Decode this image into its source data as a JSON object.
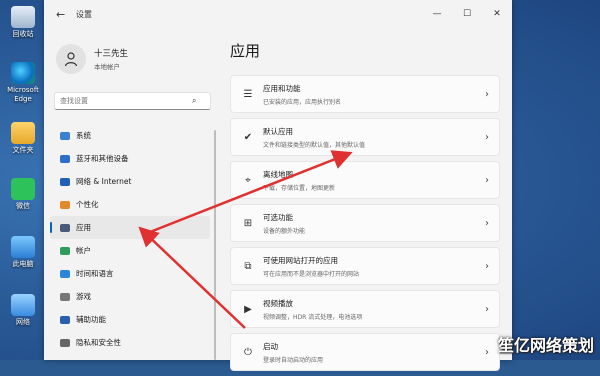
{
  "desktop": {
    "icons": [
      {
        "label": "回收站"
      },
      {
        "label": "Microsoft Edge"
      },
      {
        "label": "文件夹"
      },
      {
        "label": "微信"
      },
      {
        "label": "此电脑"
      },
      {
        "label": "网络"
      }
    ]
  },
  "window": {
    "title": "设置",
    "back_glyph": "←",
    "minimize": "—",
    "maximize": "☐",
    "close": "✕"
  },
  "user": {
    "name": "十三先生",
    "account": "本地帐户"
  },
  "search": {
    "placeholder": "查找设置",
    "icon": "⌕"
  },
  "nav": {
    "items": [
      {
        "label": "系统",
        "icon": "monitor-icon",
        "color": "#3b7fd1"
      },
      {
        "label": "蓝牙和其他设备",
        "icon": "bluetooth-icon",
        "color": "#2b6fc9"
      },
      {
        "label": "网络 & Internet",
        "icon": "wifi-icon",
        "color": "#1f5fb8"
      },
      {
        "label": "个性化",
        "icon": "brush-icon",
        "color": "#e38a2b"
      },
      {
        "label": "应用",
        "icon": "apps-icon",
        "color": "#4a5b7a"
      },
      {
        "label": "帐户",
        "icon": "account-icon",
        "color": "#2e9c5a"
      },
      {
        "label": "时间和语言",
        "icon": "globe-clock-icon",
        "color": "#2a86d8"
      },
      {
        "label": "游戏",
        "icon": "gamepad-icon",
        "color": "#777777"
      },
      {
        "label": "辅助功能",
        "icon": "accessibility-icon",
        "color": "#2a5fb0"
      },
      {
        "label": "隐私和安全性",
        "icon": "shield-icon",
        "color": "#666666"
      }
    ],
    "active_index": 4
  },
  "main": {
    "title": "应用",
    "cards": [
      {
        "title": "应用和功能",
        "subtitle": "已安装的应用，应用执行别名",
        "icon": "list-icon",
        "glyph": "☰"
      },
      {
        "title": "默认应用",
        "subtitle": "文件和链接类型的默认值，其他默认值",
        "icon": "default-apps-icon",
        "glyph": "✔"
      },
      {
        "title": "离线地图",
        "subtitle": "下载，存储位置，地图更新",
        "icon": "map-icon",
        "glyph": "⌖"
      },
      {
        "title": "可选功能",
        "subtitle": "设备的额外功能",
        "icon": "optional-features-icon",
        "glyph": "⊞"
      },
      {
        "title": "可使用网站打开的应用",
        "subtitle": "可在应用而不是浏览器中打开的网站",
        "icon": "web-apps-icon",
        "glyph": "⧉"
      },
      {
        "title": "视频播放",
        "subtitle": "视频调整，HDR 流式处理，电池选项",
        "icon": "video-icon",
        "glyph": "▶"
      },
      {
        "title": "启动",
        "subtitle": "登录时自动启动的应用",
        "icon": "startup-icon",
        "glyph": "⏻"
      }
    ],
    "chevron": "›"
  },
  "watermark": "笙亿网络策划",
  "colors": {
    "accent": "#0067c0",
    "arrow": "#e03030"
  }
}
